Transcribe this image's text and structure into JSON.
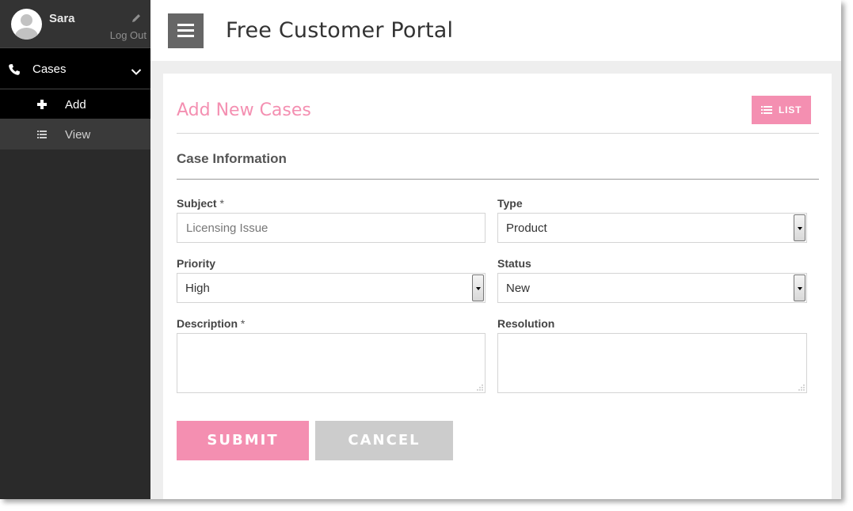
{
  "user": {
    "name": "Sara",
    "logout_label": "Log Out",
    "edit_icon": "pencil-icon",
    "avatar_icon": "user-avatar-icon"
  },
  "sidebar": {
    "section": {
      "label": "Cases",
      "icon": "phone-icon",
      "toggle_icon": "chevron-down-icon"
    },
    "items": [
      {
        "label": "Add",
        "icon": "plus-icon"
      },
      {
        "label": "View",
        "icon": "list-icon"
      }
    ]
  },
  "header": {
    "title": "Free Customer Portal",
    "menu_icon": "hamburger-menu-icon"
  },
  "page": {
    "title": "Add New Cases",
    "list_button": "LIST",
    "section_title": "Case Information"
  },
  "form": {
    "subject": {
      "label": "Subject",
      "required_mark": "*",
      "placeholder": "Licensing Issue",
      "value": ""
    },
    "type": {
      "label": "Type",
      "value": "Product"
    },
    "priority": {
      "label": "Priority",
      "value": "High"
    },
    "status": {
      "label": "Status",
      "value": "New"
    },
    "description": {
      "label": "Description",
      "required_mark": "*",
      "value": ""
    },
    "resolution": {
      "label": "Resolution",
      "value": ""
    }
  },
  "actions": {
    "submit": "SUBMIT",
    "cancel": "CANCEL"
  },
  "colors": {
    "accent": "#f48fb1",
    "sidebar": "#2a2a2a",
    "sidebar_active": "#000000",
    "cancel": "#cccccc",
    "header_button": "#666666"
  }
}
